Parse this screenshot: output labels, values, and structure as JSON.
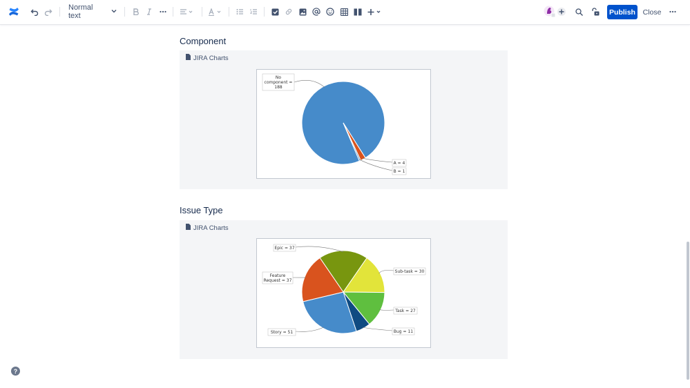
{
  "toolbar": {
    "text_style": "Normal text",
    "publish_label": "Publish",
    "close_label": "Close",
    "brand_color": "#0052cc"
  },
  "sections": [
    {
      "heading": "Component",
      "panel_title": "JIRA Charts"
    },
    {
      "heading": "Issue Type",
      "panel_title": "JIRA Charts"
    }
  ],
  "chart_data": [
    {
      "type": "pie",
      "title": "",
      "slices": [
        {
          "label": "No component = 188",
          "value": 188,
          "color": "#468bca"
        },
        {
          "label": "A = 4",
          "value": 4,
          "color": "#d9531e"
        },
        {
          "label": "B = 1",
          "value": 1,
          "color": "#468bca"
        }
      ]
    },
    {
      "type": "pie",
      "title": "",
      "slices": [
        {
          "label": "Epic = 37",
          "value": 37,
          "color": "#78960f"
        },
        {
          "label": "Sub-task = 30",
          "value": 30,
          "color": "#e2e43a"
        },
        {
          "label": "Task = 27",
          "value": 27,
          "color": "#5fbf3f"
        },
        {
          "label": "Bug = 11",
          "value": 11,
          "color": "#0f4b82"
        },
        {
          "label": "Story = 51",
          "value": 51,
          "color": "#468bca"
        },
        {
          "label": "Feature Request = 37",
          "value": 37,
          "color": "#d9531e"
        }
      ]
    }
  ]
}
